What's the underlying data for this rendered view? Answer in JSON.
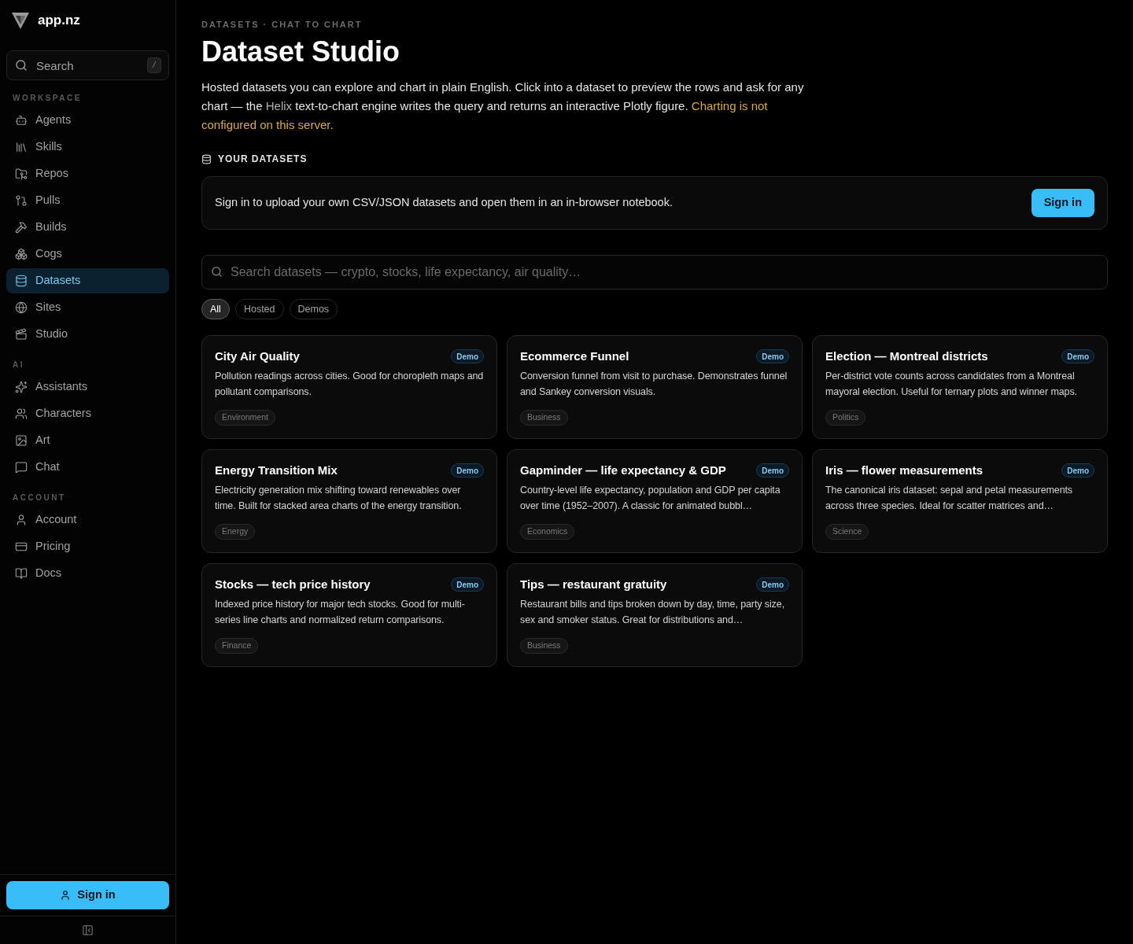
{
  "sidebar": {
    "brand": "app.nz",
    "search": {
      "placeholder": "Search",
      "shortcut": "/"
    },
    "sections": [
      {
        "title": "WORKSPACE",
        "items": [
          {
            "label": "Agents",
            "selected": false
          },
          {
            "label": "Skills",
            "selected": false
          },
          {
            "label": "Repos",
            "selected": false
          },
          {
            "label": "Pulls",
            "selected": false
          },
          {
            "label": "Builds",
            "selected": false
          },
          {
            "label": "Cogs",
            "selected": false
          },
          {
            "label": "Datasets",
            "selected": true
          },
          {
            "label": "Sites",
            "selected": false
          },
          {
            "label": "Studio",
            "selected": false
          }
        ]
      },
      {
        "title": "AI",
        "items": [
          {
            "label": "Assistants",
            "selected": false
          },
          {
            "label": "Characters",
            "selected": false
          },
          {
            "label": "Art",
            "selected": false
          },
          {
            "label": "Chat",
            "selected": false
          }
        ]
      },
      {
        "title": "ACCOUNT",
        "items": [
          {
            "label": "Account",
            "selected": false
          },
          {
            "label": "Pricing",
            "selected": false
          },
          {
            "label": "Docs",
            "selected": false
          }
        ]
      }
    ],
    "sign_in_button": "Sign in"
  },
  "page": {
    "breadcrumb": "DATASETS · CHAT TO CHART",
    "title": "Dataset Studio",
    "intro": [
      {
        "kind": "plain",
        "text": "Hosted datasets you can explore and chart in plain English. Click into a dataset to preview the rows and ask for any chart — the "
      },
      {
        "kind": "muted",
        "text": "Helix"
      },
      {
        "kind": "plain",
        "text": " text-to-chart engine writes the query and returns an interactive Plotly figure. "
      },
      {
        "kind": "warning",
        "text": "Charting is not configured on this server."
      }
    ],
    "section_title": "YOUR DATASETS",
    "sign_in_card": {
      "message": "Sign in to upload your own CSV/JSON datasets and open them in an in-browser notebook.",
      "button": "Sign in"
    },
    "search": {
      "placeholder": "Search datasets — crypto, stocks, life expectancy, air quality…"
    },
    "filters": [
      {
        "label": "All",
        "selected": true
      },
      {
        "label": "Hosted",
        "selected": false
      },
      {
        "label": "Demos",
        "selected": false
      }
    ],
    "datasets": [
      {
        "title": "City Air Quality",
        "badge": "Demo",
        "description": "Pollution readings across cities. Good for choropleth maps and pollutant comparisons.",
        "tag": "Environment"
      },
      {
        "title": "Ecommerce Funnel",
        "badge": "Demo",
        "description": "Conversion funnel from visit to purchase. Demonstrates funnel and Sankey conversion visuals.",
        "tag": "Business"
      },
      {
        "title": "Election — Montreal districts",
        "badge": "Demo",
        "description": "Per-district vote counts across candidates from a Montreal mayoral election. Useful for ternary plots and winner maps.",
        "tag": "Politics"
      },
      {
        "title": "Energy Transition Mix",
        "badge": "Demo",
        "description": "Electricity generation mix shifting toward renewables over time. Built for stacked area charts of the energy transition.",
        "tag": "Energy"
      },
      {
        "title": "Gapminder — life expectancy & GDP",
        "badge": "Demo",
        "description": "Country-level life expectancy, population and GDP per capita over time (1952–2007). A classic for animated bubbl…",
        "tag": "Economics"
      },
      {
        "title": "Iris — flower measurements",
        "badge": "Demo",
        "description": "The canonical iris dataset: sepal and petal measurements across three species. Ideal for scatter matrices and…",
        "tag": "Science"
      },
      {
        "title": "Stocks — tech price history",
        "badge": "Demo",
        "description": "Indexed price history for major tech stocks. Good for multi-series line charts and normalized return comparisons.",
        "tag": "Finance"
      },
      {
        "title": "Tips — restaurant gratuity",
        "badge": "Demo",
        "description": "Restaurant bills and tips broken down by day, time, party size, sex and smoker status. Great for distributions and…",
        "tag": "Business"
      }
    ]
  }
}
